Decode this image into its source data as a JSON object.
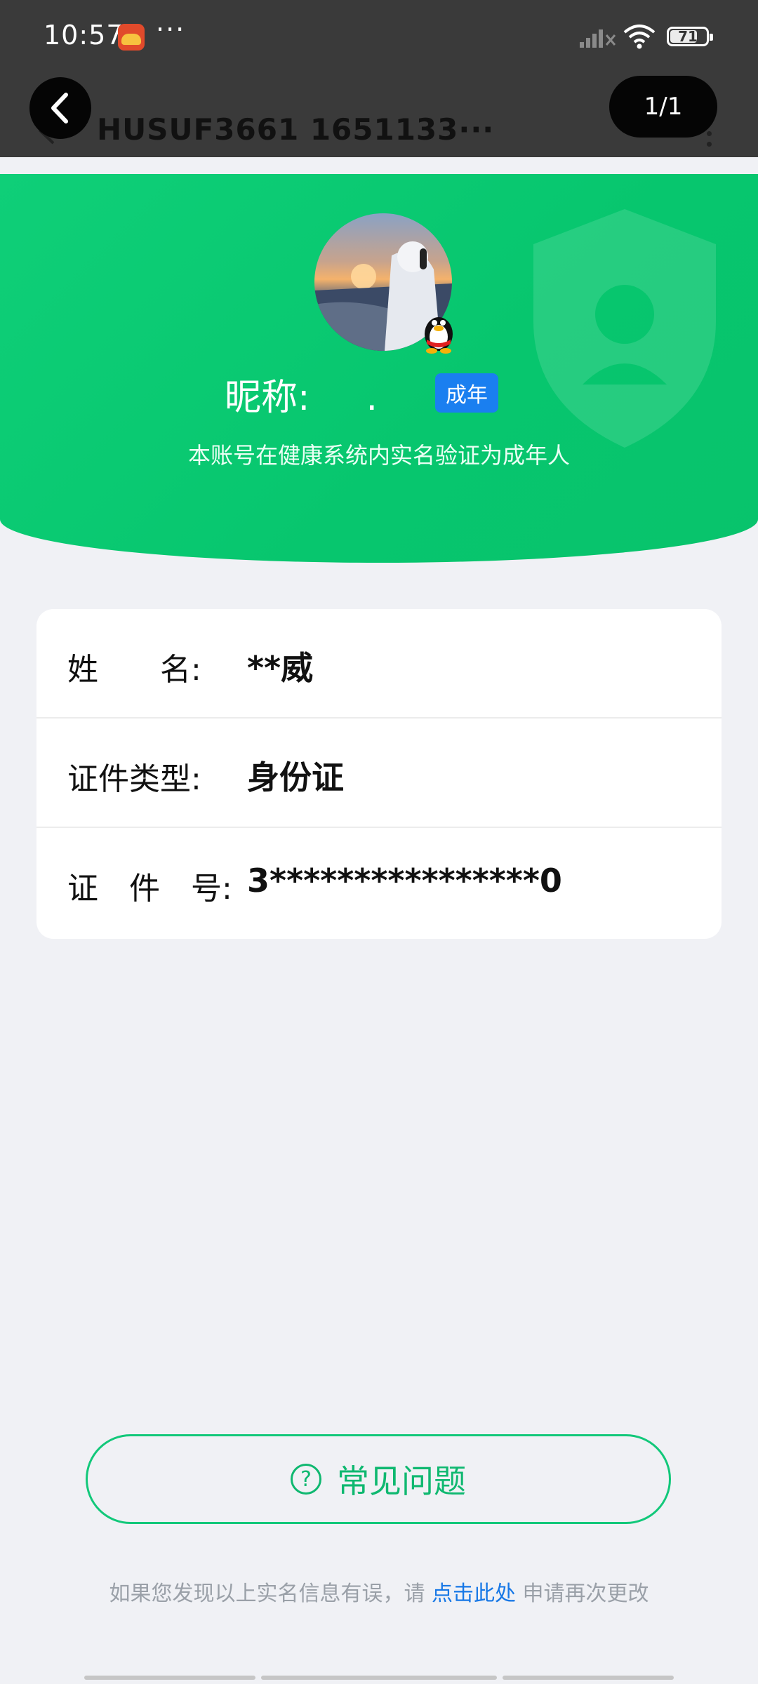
{
  "status_bar": {
    "time": "10:57",
    "more": "···",
    "battery_level": "71"
  },
  "header": {
    "title": "HUSUF3661 1651133···",
    "page_indicator": "1/1"
  },
  "profile": {
    "nickname_label": "昵称:",
    "nickname_value": ".",
    "adult_badge": "成年",
    "verify_text": "本账号在健康系统内实名验证为成年人"
  },
  "info": {
    "rows": [
      {
        "label": "姓　　名:",
        "value": "**威"
      },
      {
        "label": "证件类型:",
        "value": "身份证"
      },
      {
        "label": "证　件　号:",
        "value": "3****************0"
      }
    ]
  },
  "faq": {
    "icon_glyph": "?",
    "label": "常见问题"
  },
  "footer": {
    "prefix": "如果您发现以上实名信息有误，请 ",
    "link": "点击此处",
    "suffix": " 申请再次更改"
  },
  "colors": {
    "accent_green": "#07c66e",
    "badge_blue": "#1a7ff0",
    "link_blue": "#1677e6"
  }
}
